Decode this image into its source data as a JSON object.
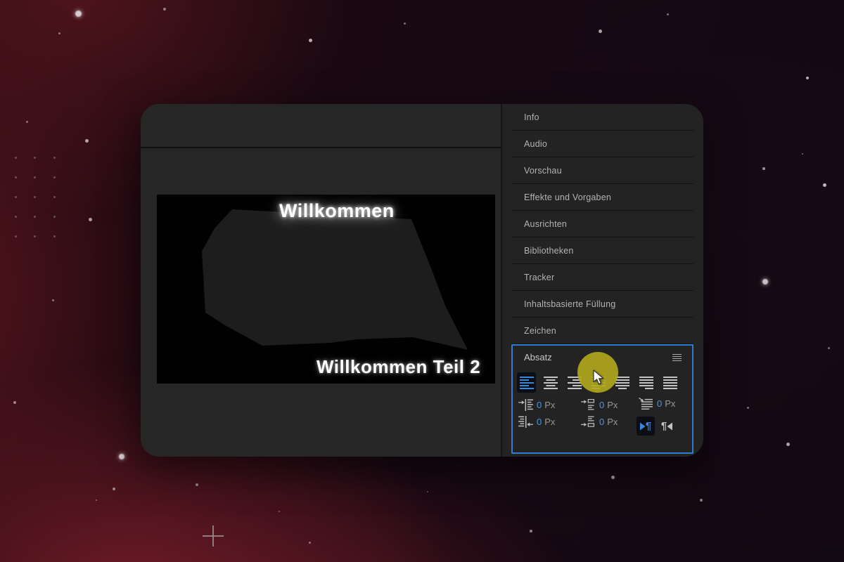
{
  "panel_tabs": [
    "Info",
    "Audio",
    "Vorschau",
    "Effekte und Vorgaben",
    "Ausrichten",
    "Bibliotheken",
    "Tracker",
    "Inhaltsbasierte Füllung",
    "Zeichen"
  ],
  "paragraph_panel": {
    "title": "Absatz",
    "alignments": [
      {
        "name": "align-left",
        "selected": true
      },
      {
        "name": "align-center",
        "selected": false
      },
      {
        "name": "align-right",
        "selected": false
      },
      {
        "name": "justify-last-left",
        "selected": false
      },
      {
        "name": "justify-last-center",
        "selected": false
      },
      {
        "name": "justify-last-right",
        "selected": false
      },
      {
        "name": "justify-all",
        "selected": false
      }
    ],
    "indents": [
      {
        "name": "indent-left",
        "value": "0",
        "unit": "Px"
      },
      {
        "name": "space-before",
        "value": "0",
        "unit": "Px"
      },
      {
        "name": "first-line-indent",
        "value": "0",
        "unit": "Px"
      },
      {
        "name": "indent-right",
        "value": "0",
        "unit": "Px"
      },
      {
        "name": "space-after",
        "value": "0",
        "unit": "Px"
      }
    ],
    "direction_buttons": [
      {
        "name": "text-direction-ltr",
        "selected": true
      },
      {
        "name": "text-direction-rtl",
        "selected": false
      }
    ]
  },
  "composition": {
    "heading": "Willkommen",
    "subheading": "Willkommen Teil 2"
  },
  "colors": {
    "accent_blue": "#3b86dd",
    "value_blue": "#4a97e8",
    "highlight_yellow": "#b4aa1d",
    "panel_outline_blue": "#2c7cd4"
  }
}
